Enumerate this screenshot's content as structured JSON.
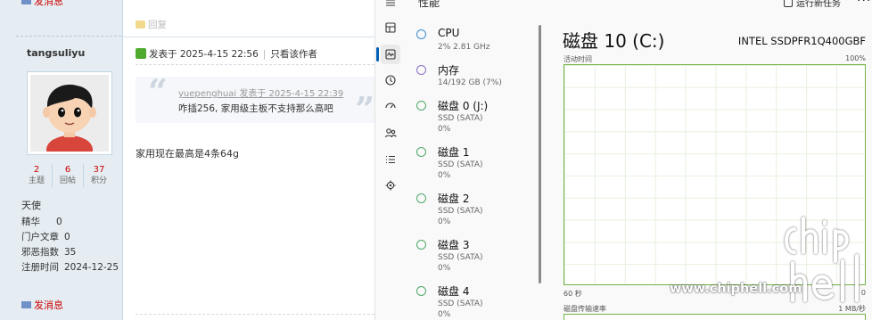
{
  "forum": {
    "sidebar": {
      "pm_top": "发消息",
      "username": "tangsuliyu",
      "stats": [
        {
          "value": "2",
          "label": "主题"
        },
        {
          "value": "6",
          "label": "回帖"
        },
        {
          "value": "37",
          "label": "积分"
        }
      ],
      "rank": "天使",
      "info": [
        {
          "key": "精华",
          "value": "0"
        },
        {
          "key": "门户文章",
          "value": "0"
        },
        {
          "key": "邪恶指数",
          "value": "35"
        },
        {
          "key": "注册时间",
          "value": "2024-12-25"
        }
      ],
      "pm_bottom": "发消息"
    },
    "post": {
      "reply_label": "回复",
      "posted_at": "发表于 2025-4-15 22:56",
      "only_author": "只看该作者",
      "quote_header": "yuepenghuai 发表于 2025-4-15 22:39",
      "quote_text": "咋插256, 家用级主板不支持那么高吧",
      "body": "家用现在最高是4条64g"
    }
  },
  "taskmgr": {
    "title": "性能",
    "run_task": "运行新任务",
    "more": "···",
    "accent": "#005fb8",
    "nav_icons": [
      "hamburger-icon",
      "processes-icon",
      "performance-icon",
      "app-history-icon",
      "startup-icon",
      "users-icon",
      "details-icon",
      "services-icon"
    ],
    "perf_items": [
      {
        "name": "CPU",
        "sub1": "2% 2.81 GHz",
        "sub2": "",
        "color": "#3c8dd0"
      },
      {
        "name": "内存",
        "sub1": "14/192 GB (7%)",
        "sub2": "",
        "color": "#8b72c9"
      },
      {
        "name": "磁盘 0 (J:)",
        "sub1": "SSD (SATA)",
        "sub2": "0%",
        "color": "#4fa96a"
      },
      {
        "name": "磁盘 1",
        "sub1": "SSD (SATA)",
        "sub2": "0%",
        "color": "#4fa96a"
      },
      {
        "name": "磁盘 2",
        "sub1": "SSD (SATA)",
        "sub2": "0%",
        "color": "#4fa96a"
      },
      {
        "name": "磁盘 3",
        "sub1": "SSD (SATA)",
        "sub2": "0%",
        "color": "#4fa96a"
      },
      {
        "name": "磁盘 4",
        "sub1": "SSD (SATA)",
        "sub2": "0%",
        "color": "#4fa96a"
      }
    ],
    "detail": {
      "disk_title": "磁盘 10 (C:)",
      "disk_model": "INTEL SSDPFR1Q400GBF",
      "graph_label": "活动时间",
      "graph_max": "100%",
      "graph_time": "60 秒",
      "graph_zero": "0",
      "graph2_label": "磁盘传输速率",
      "graph2_max": "1 MB/秒"
    }
  },
  "watermark": {
    "text": "www.chiphell.com",
    "logo": "chiphell"
  }
}
